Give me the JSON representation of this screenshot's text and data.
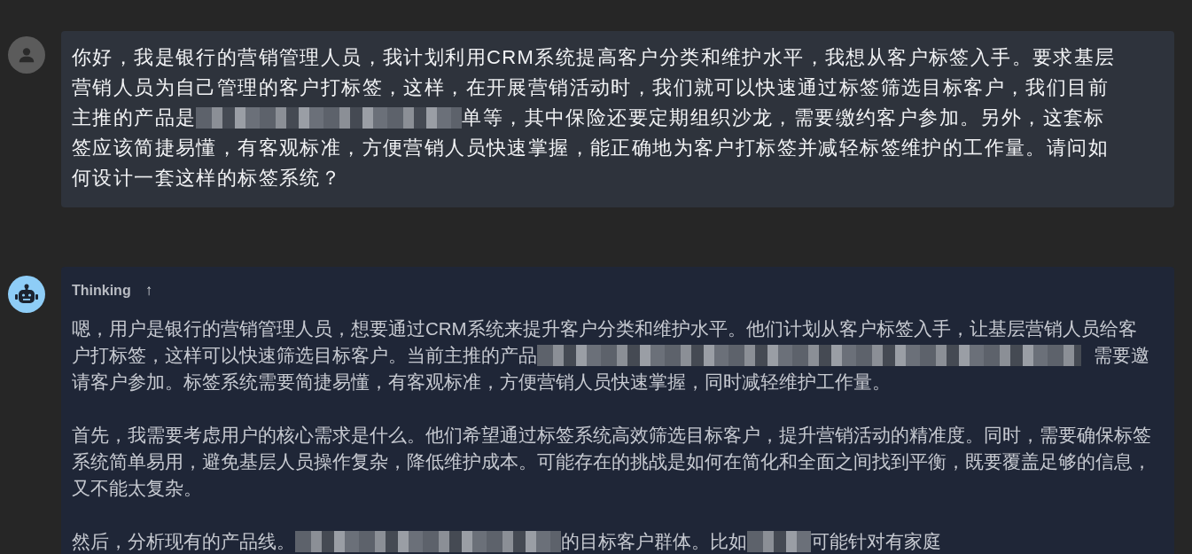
{
  "messages": [
    {
      "kind": "user",
      "paragraphs": [
        [
          [
            {
              "kind": "text",
              "text": "你好，我是银行的营销管理人员，我计划利用CRM系统提高客户分类和维护水平，我想从客户标签入手。要求基层"
            }
          ],
          [
            {
              "kind": "text",
              "text": "营销人员为自己管理的客户打标签，这样，在开展营销活动时，我们就可以快速通过标签筛选目标客户，我们目前"
            }
          ],
          [
            {
              "kind": "text",
              "text": "主推的产品是"
            },
            {
              "kind": "mosaic"
            },
            {
              "kind": "text",
              "text": "单等，其中保险还要定期组织沙龙，需要缴约客户参加。另外，这套标"
            }
          ],
          [
            {
              "kind": "text",
              "text": "签应该简捷易懂，有客观标准，方便营销人员快速掌握，能正确地为客户打标签并减轻标签维护的工作量。请问如"
            }
          ],
          [
            {
              "kind": "text",
              "text": "何设计一套这样的标签系统？"
            }
          ]
        ]
      ]
    },
    {
      "kind": "assistant",
      "thinking": {
        "label": "Thinking",
        "toggle": "↑"
      },
      "paragraphs": [
        [
          [
            {
              "kind": "text",
              "text": "嗯，用户是银行的营销管理人员，想要通过CRM系统来提升客户分类和维护水平。他们计划从客户标签入手，让基层营销人员给客"
            }
          ],
          [
            {
              "kind": "text",
              "text": "户打标签，这样可以快速筛选目标客户。当前主推的产品"
            },
            {
              "kind": "band"
            },
            {
              "kind": "text",
              "text": "需要邀"
            }
          ],
          [
            {
              "kind": "text",
              "text": "请客户参加。标签系统需要简捷易懂，有客观标准，方便营销人员快速掌握，同时减轻维护工作量。"
            }
          ]
        ],
        [
          [
            {
              "kind": "text",
              "text": "首先，我需要考虑用户的核心需求是什么。他们希望通过标签系统高效筛选目标客户，提升营销活动的精准度。同时，需要确保标签"
            }
          ],
          [
            {
              "kind": "text",
              "text": "系统简单易用，避免基层人员操作复杂，降低维护成本。可能存在的挑战是如何在简化和全面之间找到平衡，既要覆盖足够的信息，"
            }
          ],
          [
            {
              "kind": "text",
              "text": "又不能太复杂。"
            }
          ]
        ],
        [
          [
            {
              "kind": "text",
              "text": "然后，分析现有的产品线。"
            },
            {
              "kind": "mosaic"
            },
            {
              "kind": "text",
              "text": "的目标客户群体。比如"
            },
            {
              "kind": "blot"
            },
            {
              "kind": "text",
              "text": "可能针对有家庭"
            }
          ]
        ]
      ]
    }
  ]
}
